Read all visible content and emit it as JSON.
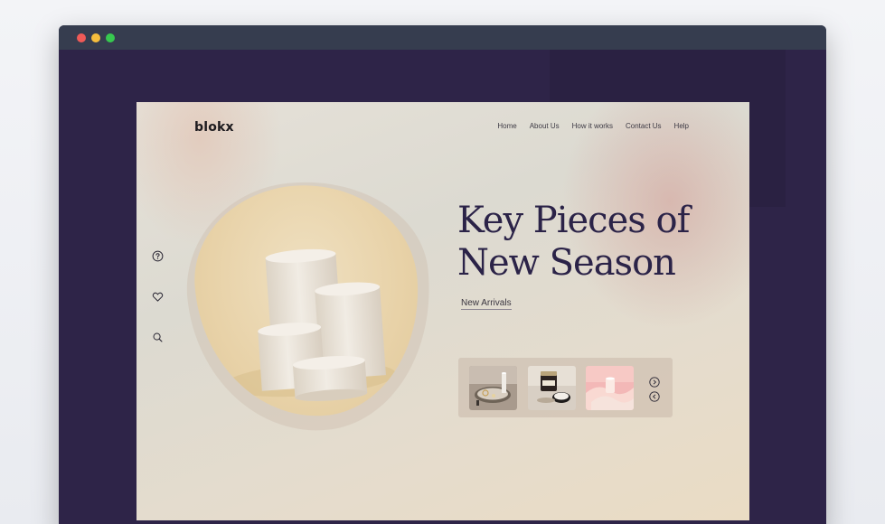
{
  "window": {
    "controls": [
      "close",
      "minimize",
      "maximize"
    ],
    "colors": {
      "titlebar": "#363d4f",
      "backdrop": "#2e2448"
    }
  },
  "site": {
    "logo": "blokx",
    "nav": [
      {
        "label": "Home"
      },
      {
        "label": "About Us"
      },
      {
        "label": "How it works"
      },
      {
        "label": "Contact Us"
      },
      {
        "label": "Help"
      }
    ],
    "side_icons": [
      "help-circle-icon",
      "heart-icon",
      "search-icon"
    ],
    "hero": {
      "headline_line1": "Key Pieces of",
      "headline_line2": "New Season",
      "cta": "New Arrivals"
    },
    "carousel": {
      "items": [
        {
          "image": "jewelry-tray-photo"
        },
        {
          "image": "candle-jar-photo"
        },
        {
          "image": "pink-silk-photo"
        }
      ],
      "controls": [
        "next-arrow-icon",
        "prev-arrow-icon"
      ]
    },
    "colors": {
      "headline": "#2b2348",
      "accent_blush": "#d6b2aa",
      "blob": "#e8d2a8"
    }
  }
}
